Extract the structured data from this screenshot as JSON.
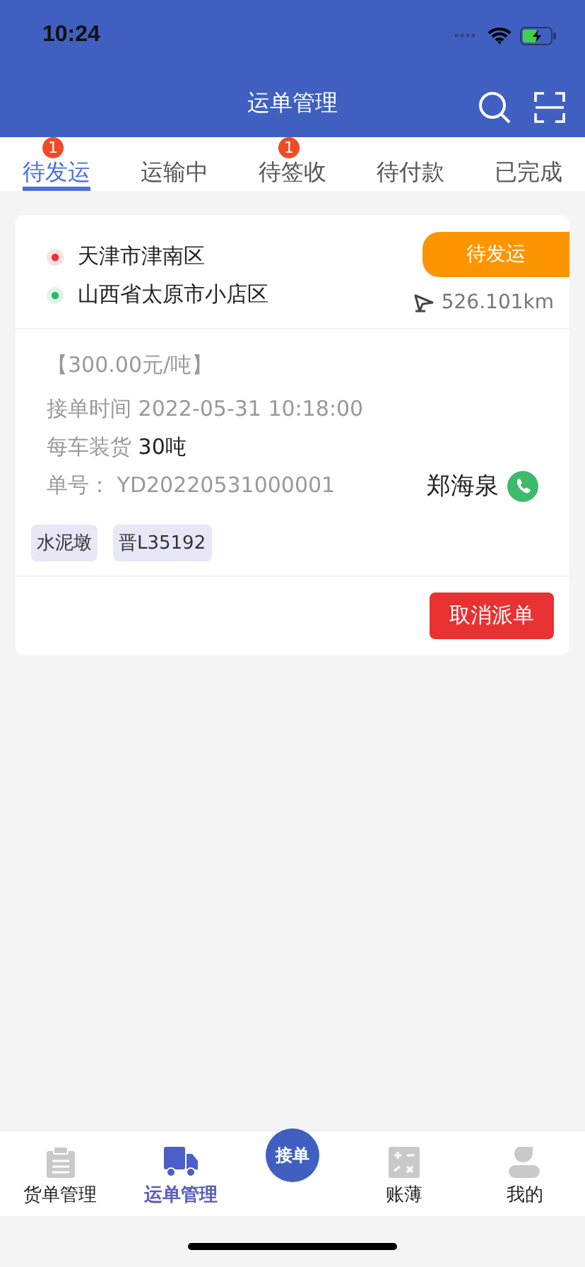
{
  "status_bar": {
    "time": "10:24"
  },
  "header": {
    "title": "运单管理"
  },
  "tabs": [
    {
      "label": "待发运",
      "selected": true,
      "badge": "1"
    },
    {
      "label": "运输中",
      "selected": false
    },
    {
      "label": "待签收",
      "selected": false,
      "badge": "1"
    },
    {
      "label": "待付款",
      "selected": false
    },
    {
      "label": "已完成",
      "selected": false
    }
  ],
  "orders": [
    {
      "route": [
        {
          "place": "天津市津南区",
          "color": "#e8323c"
        },
        {
          "place": "山西省太原市小店区",
          "color": "#2fb86a"
        }
      ],
      "status": "待发运",
      "distance": "526.101km",
      "price": "【300.00元/吨】",
      "fields": [
        {
          "label": "接单时间",
          "value": "2022-05-31 10:18:00",
          "kind": "muted"
        },
        {
          "label": "每车装货",
          "value": "30吨",
          "kind": "strong"
        },
        {
          "label": "单号：",
          "value": "YD20220531000001",
          "kind": "muted"
        }
      ],
      "driver": "郑海泉",
      "tags": [
        "水泥墩",
        "晋L35192"
      ],
      "action": "取消派单"
    }
  ],
  "bottom_nav": [
    {
      "label": "货单管理",
      "kind": "icon",
      "selected": false
    },
    {
      "label": "运单管理",
      "kind": "icon",
      "selected": true
    },
    {
      "label": "接单",
      "kind": "center"
    },
    {
      "label": "账薄",
      "kind": "icon",
      "selected": false
    },
    {
      "label": "我的",
      "kind": "icon",
      "selected": false
    }
  ]
}
